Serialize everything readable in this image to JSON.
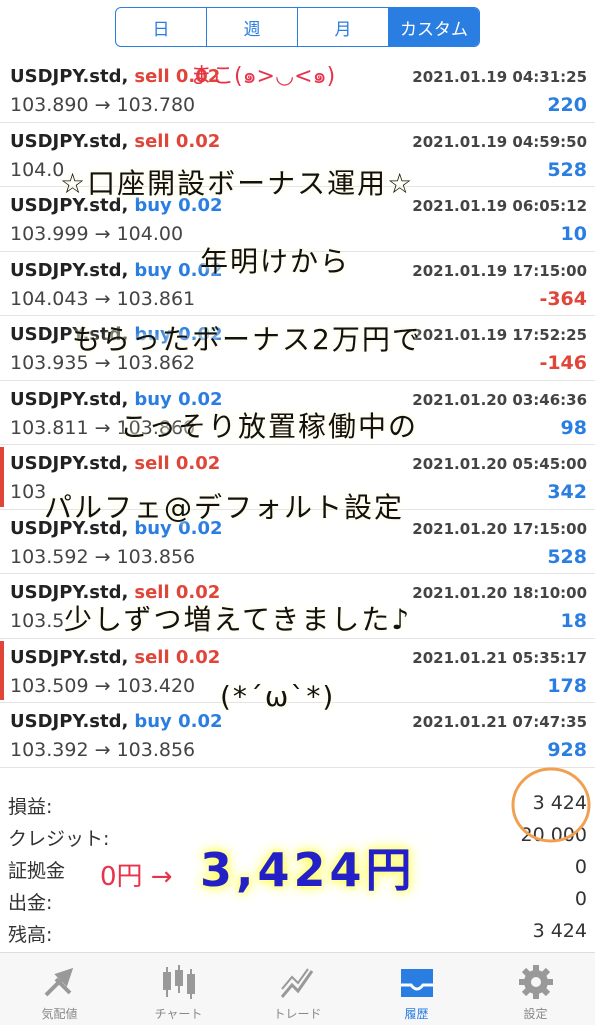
{
  "tabs_segment": [
    "日",
    "週",
    "月",
    "カスタム"
  ],
  "trades": [
    {
      "symbol": "USDJPY.std,",
      "side": "sell",
      "lot": "0.02",
      "datetime": "2021.01.19 04:31:25",
      "prices": "103.890 → 103.780",
      "profit": "220",
      "negative": false,
      "mark": false
    },
    {
      "symbol": "USDJPY.std,",
      "side": "sell",
      "lot": "0.02",
      "datetime": "2021.01.19 04:59:50",
      "prices": "104.0",
      "profit": "528",
      "negative": false,
      "mark": false
    },
    {
      "symbol": "USDJPY.std,",
      "side": "buy",
      "lot": "0.02",
      "datetime": "2021.01.19 06:05:12",
      "prices": "103.999 → 104.00",
      "profit": "10",
      "negative": false,
      "mark": false
    },
    {
      "symbol": "USDJPY.std,",
      "side": "buy",
      "lot": "0.02",
      "datetime": "2021.01.19 17:15:00",
      "prices": "104.043 → 103.861",
      "profit": "-364",
      "negative": true,
      "mark": false
    },
    {
      "symbol": "USDJPY.std,",
      "side": "buy",
      "lot": "0.02",
      "datetime": "2021.01.19 17:52:25",
      "prices": "103.935 → 103.862",
      "profit": "-146",
      "negative": true,
      "mark": false
    },
    {
      "symbol": "USDJPY.std,",
      "side": "buy",
      "lot": "0.02",
      "datetime": "2021.01.20 03:46:36",
      "prices": "103.811 → 103.860",
      "profit": "98",
      "negative": false,
      "mark": false
    },
    {
      "symbol": "USDJPY.std,",
      "side": "sell",
      "lot": "0.02",
      "datetime": "2021.01.20 05:45:00",
      "prices": "103",
      "profit": "342",
      "negative": false,
      "mark": true
    },
    {
      "symbol": "USDJPY.std,",
      "side": "buy",
      "lot": "0.02",
      "datetime": "2021.01.20 17:15:00",
      "prices": "103.592 → 103.856",
      "profit": "528",
      "negative": false,
      "mark": false
    },
    {
      "symbol": "USDJPY.std,",
      "side": "sell",
      "lot": "0.02",
      "datetime": "2021.01.20 18:10:00",
      "prices": "103.5",
      "profit": "18",
      "negative": false,
      "mark": false
    },
    {
      "symbol": "USDJPY.std,",
      "side": "sell",
      "lot": "0.02",
      "datetime": "2021.01.21 05:35:17",
      "prices": "103.509 → 103.420",
      "profit": "178",
      "negative": false,
      "mark": true
    },
    {
      "symbol": "USDJPY.std,",
      "side": "buy",
      "lot": "0.02",
      "datetime": "2021.01.21 07:47:35",
      "prices": "103.392 → 103.856",
      "profit": "928",
      "negative": false,
      "mark": false
    }
  ],
  "summary": [
    {
      "label": "損益:",
      "value": "3 424"
    },
    {
      "label": "クレジット:",
      "value": "20 000"
    },
    {
      "label": "証拠金",
      "value": "0"
    },
    {
      "label": "出金:",
      "value": "0"
    },
    {
      "label": "残高:",
      "value": "3 424"
    }
  ],
  "bottom_tabs": [
    {
      "label": "気配値",
      "icon": "quotes-icon"
    },
    {
      "label": "チャート",
      "icon": "chart-candles-icon"
    },
    {
      "label": "トレード",
      "icon": "trade-icon"
    },
    {
      "label": "履歴",
      "icon": "history-inbox-icon"
    },
    {
      "label": "設定",
      "icon": "gear-icon"
    }
  ],
  "handwriting": {
    "top": "まこ(๑>◡<๑)",
    "line1": "☆口座開設ボーナス運用☆",
    "line2": "年明けから",
    "line3": "もらったボーナス2万円で",
    "line4": "こっそり放置稼働中の",
    "line5": "パルフェ@デフォルト設定",
    "line6": "少しずつ増えてきました♪",
    "line7": "(*´ω`*)",
    "from": "0円 →",
    "total": "3,424円"
  },
  "colors": {
    "accent": "#2a7de1",
    "sell": "#e0453a",
    "highlight_circle": "#f0a050"
  }
}
